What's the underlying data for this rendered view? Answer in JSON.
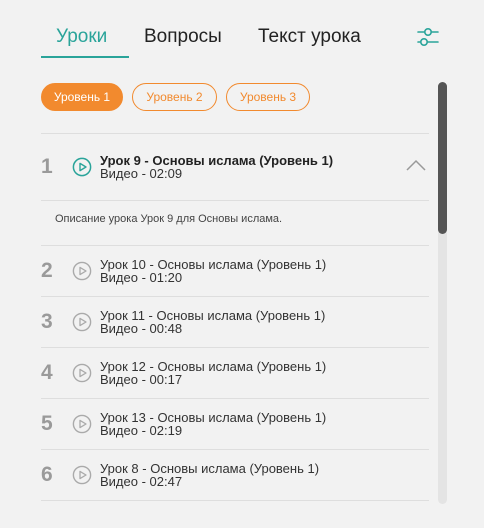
{
  "tabs": [
    {
      "label": "Уроки",
      "active": true
    },
    {
      "label": "Вопросы",
      "active": false
    },
    {
      "label": "Текст урока",
      "active": false
    }
  ],
  "filter_icon": "sliders-icon",
  "levels": [
    {
      "label": "Уровень 1",
      "active": true
    },
    {
      "label": "Уровень 2",
      "active": false
    },
    {
      "label": "Уровень 3",
      "active": false
    }
  ],
  "lessons": [
    {
      "num": "1",
      "title": "Урок 9 - Основы ислама (Уровень 1)",
      "meta": "Видео - 02:09",
      "expanded": true,
      "description": "Описание урока Урок 9 для Основы ислама."
    },
    {
      "num": "2",
      "title": "Урок 10 - Основы ислама (Уровень 1)",
      "meta": "Видео - 01:20"
    },
    {
      "num": "3",
      "title": "Урок 11 - Основы ислама (Уровень 1)",
      "meta": "Видео - 00:48"
    },
    {
      "num": "4",
      "title": "Урок 12 - Основы ислама (Уровень 1)",
      "meta": "Видео - 00:17"
    },
    {
      "num": "5",
      "title": "Урок 13 - Основы ислама (Уровень 1)",
      "meta": "Видео - 02:19"
    },
    {
      "num": "6",
      "title": "Урок 8 - Основы ислама (Уровень 1)",
      "meta": "Видео - 02:47"
    }
  ],
  "colors": {
    "accent": "#2aa49a",
    "level_accent": "#f28a2e",
    "play_active": "#2aa49a",
    "play_inactive": "#aaaaaa"
  }
}
